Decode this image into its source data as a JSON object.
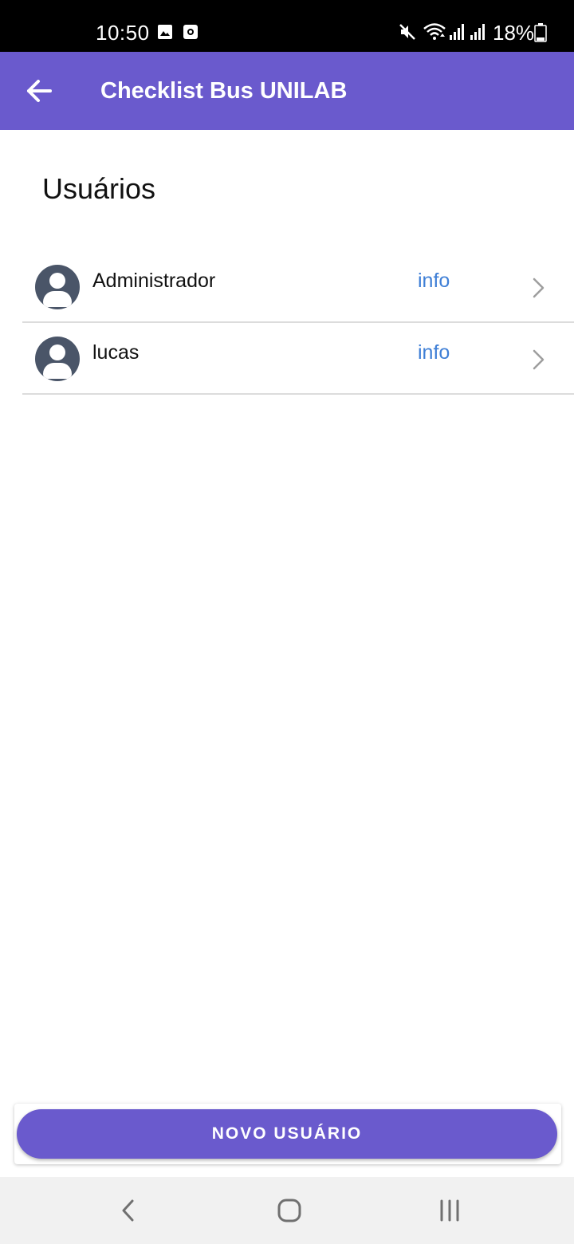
{
  "status_bar": {
    "time": "10:50",
    "battery": "18%",
    "left_icons": [
      "image-icon",
      "screen-record-icon"
    ],
    "right_icons": [
      "mute-icon",
      "wifi-icon",
      "signal-icon",
      "signal-icon",
      "battery-icon"
    ]
  },
  "app_bar": {
    "title": "Checklist Bus UNILAB",
    "background_color": "#6a5acd"
  },
  "page": {
    "heading": "Usuários"
  },
  "users": [
    {
      "name": "Administrador",
      "info_label": "info"
    },
    {
      "name": "lucas",
      "info_label": "info"
    }
  ],
  "actions": {
    "new_user_label": "NOVO USUÁRIO"
  },
  "colors": {
    "accent": "#6a5acd",
    "link": "#3f7fd6",
    "avatar": "#4a5568"
  },
  "nav_bar": {
    "buttons": [
      "back-icon",
      "home-icon",
      "recents-icon"
    ]
  }
}
